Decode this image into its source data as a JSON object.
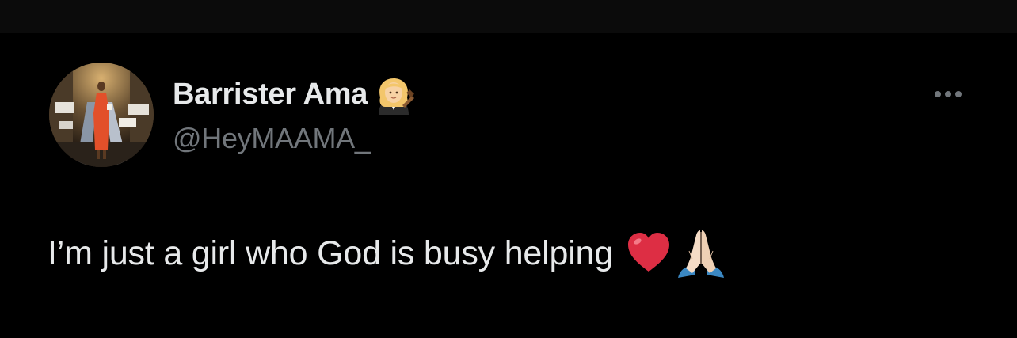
{
  "tweet": {
    "author": {
      "display_name": "Barrister Ama",
      "handle": "@HeyMAAMA_",
      "name_emoji": "woman-judge-emoji"
    },
    "text": "I’m just a girl who God is busy helping",
    "text_emojis": [
      "red-heart-emoji",
      "folded-hands-emoji"
    ],
    "more_icon": "more-horizontal-icon"
  },
  "colors": {
    "background": "#000000",
    "top_bar": "#0b0b0b",
    "primary_text": "#e7e9ea",
    "secondary_text": "#71767b"
  }
}
